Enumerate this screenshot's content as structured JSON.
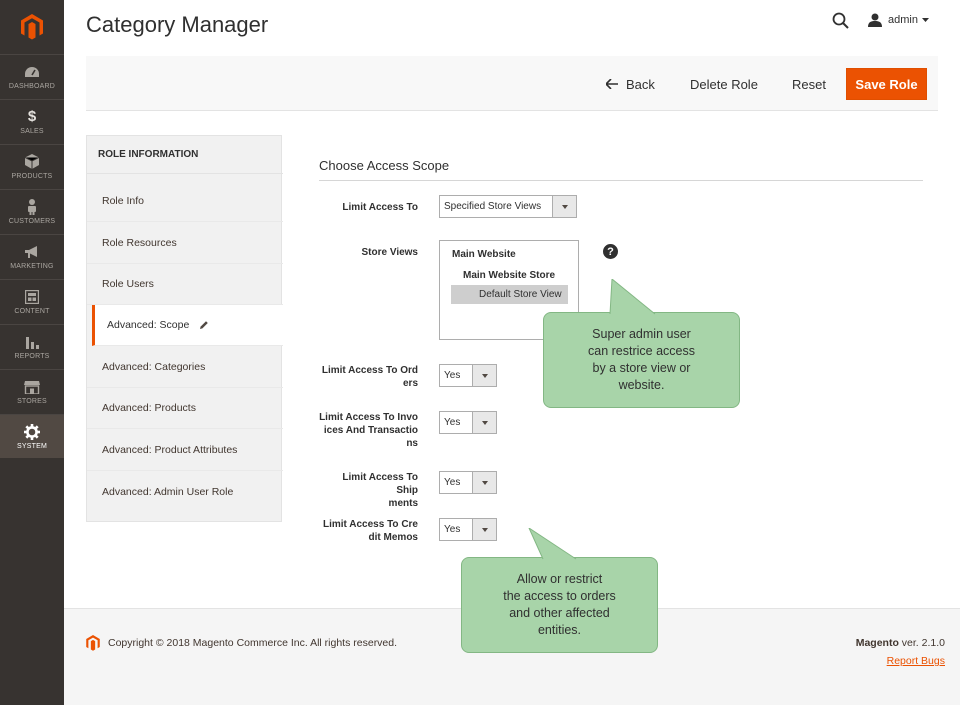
{
  "sidebar": {
    "items": [
      {
        "label": "DASHBOARD",
        "icon": "dashboard-icon"
      },
      {
        "label": "SALES",
        "icon": "dollar-icon"
      },
      {
        "label": "PRODUCTS",
        "icon": "cube-icon"
      },
      {
        "label": "CUSTOMERS",
        "icon": "person-icon"
      },
      {
        "label": "MARKETING",
        "icon": "megaphone-icon"
      },
      {
        "label": "CONTENT",
        "icon": "layout-icon"
      },
      {
        "label": "REPORTS",
        "icon": "bar-chart-icon"
      },
      {
        "label": "STORES",
        "icon": "storefront-icon"
      },
      {
        "label": "SYSTEM",
        "icon": "gear-icon"
      }
    ],
    "active": "SYSTEM"
  },
  "header": {
    "title": "Category Manager",
    "user": "admin"
  },
  "actions": {
    "back": "Back",
    "delete": "Delete Role",
    "reset": "Reset",
    "save": "Save Role"
  },
  "tabs": {
    "title": "ROLE INFORMATION",
    "items": [
      "Role Info",
      "Role Resources",
      "Role Users",
      "Advanced: Scope",
      "Advanced: Categories",
      "Advanced: Products",
      "Advanced: Product Attributes",
      "Advanced: Admin User Role"
    ],
    "active": "Advanced: Scope"
  },
  "form": {
    "section_title": "Choose Access Scope",
    "limit_access_to": {
      "label": "Limit Access To",
      "value": "Specified Store Views"
    },
    "store_views": {
      "label": "Store Views",
      "website": "Main Website",
      "store": "Main Website Store",
      "view": "Default Store View"
    },
    "orders": {
      "label_1": "Limit Access To Ord",
      "label_2": "ers",
      "value": "Yes"
    },
    "invoices": {
      "label_1": "Limit Access To Invo",
      "label_2": "ices And Transactio",
      "label_3": "ns",
      "value": "Yes"
    },
    "shipments": {
      "label_1": "Limit Access To Ship",
      "label_2": "ments",
      "value": "Yes"
    },
    "credit_memos": {
      "label_1": "Limit Access To Cre",
      "label_2": "dit Memos",
      "value": "Yes"
    }
  },
  "callouts": {
    "scope": {
      "line1": "Super admin user",
      "line2": "can restrice access",
      "line3": "by a store view or",
      "line4": "website."
    },
    "access": {
      "line1": "Allow or restrict",
      "line2": "the access to orders",
      "line3": "and other affected",
      "line4": "entities."
    }
  },
  "footer": {
    "copyright": "Copyright © 2018 Magento Commerce Inc. All rights reserved.",
    "brand": "Magento",
    "version": " ver. 2.1.0",
    "report": "Report Bugs"
  },
  "colors": {
    "accent": "#eb5202",
    "sidebar": "#373330",
    "callout": "#a8d4a9"
  }
}
